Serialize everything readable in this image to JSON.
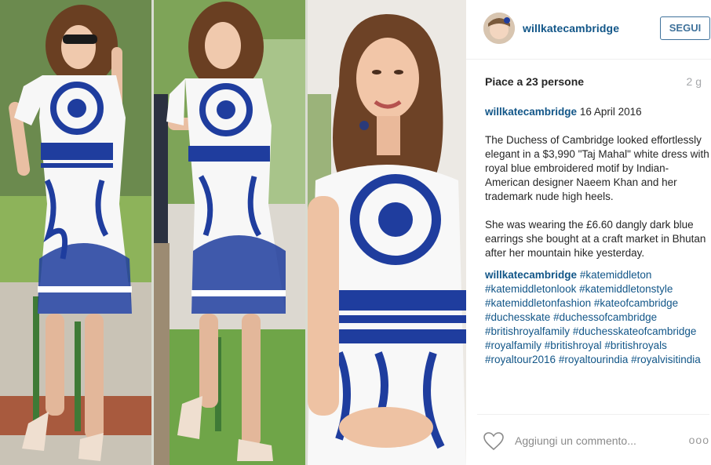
{
  "post": {
    "username": "willkatecambridge",
    "follow_label": "SEGUI",
    "likes_text": "Piace a 23 persone",
    "time_ago": "2 g",
    "first_comment": {
      "user": "willkatecambridge",
      "date": "16 April 2016",
      "paragraph_1": "The Duchess of Cambridge looked effortlessly elegant in a $3,990 \"Taj Mahal\" white dress with royal blue embroidered motif by Indian-American designer Naeem Khan and her trademark nude high heels.",
      "paragraph_2": "She was wearing the £6.60 dangly dark blue earrings she bought at a craft market in Bhutan after her mountain hike yesterday."
    },
    "second_comment": {
      "user": "willkatecambridge",
      "hashtags": [
        "#katemiddleton",
        "#katemiddletonlook",
        "#katemiddletonstyle",
        "#katemiddletonfashion",
        "#kateofcambridge",
        "#duchesskate",
        "#duchessofcambridge",
        "#britishroyalfamily",
        "#duchesskateofcambridge",
        "#royalfamily",
        "#britishroyal",
        "#britishroyals",
        "#royaltour2016",
        "#royaltourindia",
        "#royalvisitindia"
      ]
    },
    "comment_placeholder": "Aggiungi un commento...",
    "more_label": "ooo"
  },
  "icons": {
    "heart": "heart-icon",
    "more": "more-options-icon",
    "avatar": "avatar"
  },
  "colors": {
    "link": "#125688",
    "follow_border": "#3f729b",
    "dress_blue": "#1f3d9e"
  }
}
